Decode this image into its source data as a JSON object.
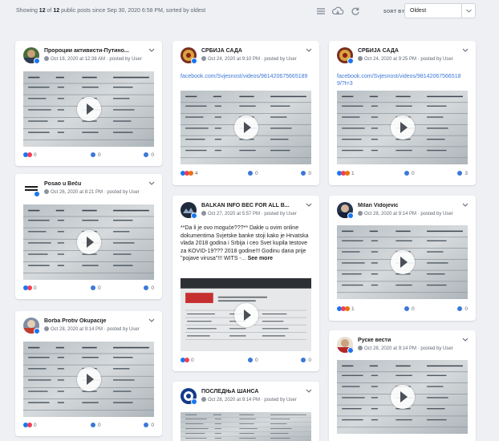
{
  "header": {
    "showing_prefix": "Showing ",
    "shown": "12",
    "of": " of ",
    "total": "12",
    "showing_suffix": " public posts since Sep 30, 2020 6:58 PM, sorted by oldest",
    "sort_label": "SORT BY",
    "sort_value": "Oldest"
  },
  "icons": {
    "list": "list-icon",
    "cloud": "cloud-download-icon",
    "refresh": "refresh-icon",
    "play": "play-icon",
    "caret": "chevron-down-icon"
  },
  "colors": {
    "link": "#3b78d8",
    "facebook": "#1877f2",
    "like": "#1877f2",
    "angry": "#e9710f",
    "haha": "#f7b125",
    "love": "#f33e58",
    "background": "#eef0f4"
  },
  "posts": [
    {
      "name": "Пророции активисти-Путино...",
      "meta": "Oct 18, 2020 at 12:38 AM · posted by User",
      "link": "",
      "text": "",
      "more": "",
      "reactions": "0",
      "comments": "0",
      "shares": "0",
      "reaction_icons": [
        "like",
        "love"
      ]
    },
    {
      "name": "Posao u Beču",
      "meta": "Oct 26, 2020 at 8:21 PM · posted by User",
      "link": "",
      "text": "",
      "more": "",
      "reactions": "0",
      "comments": "0",
      "shares": "0",
      "reaction_icons": [
        "like",
        "love"
      ]
    },
    {
      "name": "Borba Protiv Okupacije",
      "meta": "Oct 28, 2020 at 9:14 PM · posted by User",
      "link": "",
      "text": "",
      "more": "",
      "reactions": "0",
      "comments": "0",
      "shares": "0",
      "reaction_icons": [
        "like",
        "love"
      ]
    },
    {
      "name": "СРБИЈА САДА",
      "meta": "Oct 24, 2020 at 9:10 PM · posted by User",
      "link": "facebook.com/Svjesnost/videos/981420675665189",
      "text": "",
      "more": "",
      "reactions": "4",
      "comments": "0",
      "shares": "0",
      "reaction_icons": [
        "like",
        "love",
        "angry"
      ]
    },
    {
      "name": "BALKAN INFO BEČ FOR ALL B...",
      "meta": "Oct 27, 2020 at 5:57 PM · posted by User",
      "link": "",
      "text": "**Da li je ovo moguće???** Dakle u ovim online dokumentima Svjetske banke stoji kako je Hrvatska vlada 2018 godina i Srbija i ceo Svet kupila testove za KOVID-19??? 2018 godine!!! Godinu dana prije \"pojave virusa\"!!! WITS -...",
      "more": "See more",
      "reactions": "0",
      "comments": "0",
      "shares": "0",
      "reaction_icons": [
        "like",
        "love"
      ]
    },
    {
      "name": "ПОСЛЕДЊА ШАНСА",
      "meta": "Oct 28, 2020 at 9:14 PM · posted by User",
      "link": "",
      "text": "",
      "more": "",
      "reactions": "",
      "comments": "",
      "shares": "",
      "reaction_icons": []
    },
    {
      "name": "СРБИЈА САДА",
      "meta": "Oct 24, 2020 at 9:25 PM · posted by User",
      "link": "facebook.com/Svjesnost/videos/981420675665189/?t=3",
      "text": "",
      "more": "",
      "reactions": "1",
      "comments": "0",
      "shares": "3",
      "reaction_icons": [
        "like",
        "love",
        "angry"
      ]
    },
    {
      "name": "Milan Vidojevic",
      "meta": "Oct 28, 2020 at 9:14 PM · posted by User",
      "link": "",
      "text": "",
      "more": "",
      "reactions": "1",
      "comments": "0",
      "shares": "0",
      "reaction_icons": [
        "like",
        "love",
        "angry"
      ]
    },
    {
      "name": "Руске вести",
      "meta": "Oct 28, 2020 at 9:14 PM · posted by User",
      "link": "",
      "text": "",
      "more": "",
      "reactions": "",
      "comments": "",
      "shares": "",
      "reaction_icons": []
    }
  ]
}
